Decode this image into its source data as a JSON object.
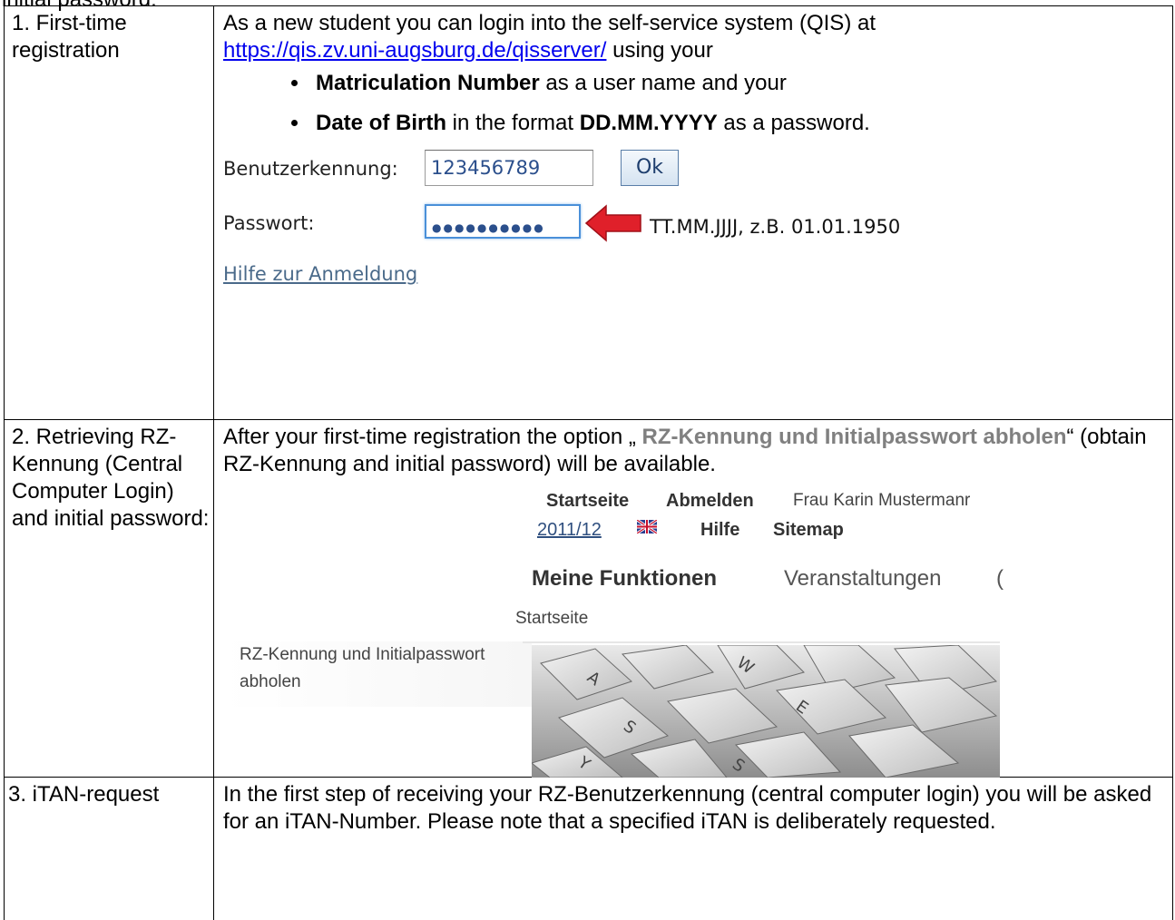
{
  "top_cut_text": "initial password:",
  "rows": [
    {
      "label": "1. First-time registration",
      "intro_pre": "As a new student you can login into the self-service system (QIS) at",
      "link": "https://qis.zv.uni-augsburg.de/qisserver/",
      "intro_post": " using your",
      "bullets": [
        {
          "bold": "Matriculation Number",
          "rest": " as a user name and your"
        },
        {
          "bold": "Date of Birth",
          "mid": " in the format ",
          "bold2": "DD.MM.YYYY",
          "rest": " as a password."
        }
      ],
      "login": {
        "user_label": "Benutzerkennung:",
        "user_value": "123456789",
        "ok_label": "Ok",
        "pass_label": "Passwort:",
        "pass_value": "●●●●●●●●●●",
        "annotation": "TT.MM.JJJJ, z.B. 01.01.1950",
        "help_link": "Hilfe zur Anmeldung"
      }
    },
    {
      "label": "2. Retrieving RZ-Kennung (Central Computer Login) and initial password:",
      "text_pre": "After your first-time registration the option „ ",
      "text_bold": "RZ-Kennung und Initialpasswort abholen",
      "text_post": "“ (obtain RZ-Kennung and initial password) will be available.",
      "qis": {
        "nav1": "Startseite",
        "nav2": "Abmelden",
        "user": "Frau Karin Mustermanr",
        "semester": "2011/12",
        "help": "Hilfe",
        "sitemap": "Sitemap",
        "tab1": "Meine Funktionen",
        "tab2": "Veranstaltungen",
        "tab3": "(",
        "breadcrumb": "Startseite",
        "option_line1": "RZ-Kennung und Initialpasswort",
        "option_line2": "abholen"
      }
    },
    {
      "label": "3. iTAN-request",
      "text": "In the first step of receiving your RZ-Benutzerkennung (central computer login) you will be asked for an iTAN-Number. Please note that a specified iTAN is deliberately requested."
    }
  ],
  "colors": {
    "link": "#0000ee",
    "arrow": "#e0202a",
    "muted_bold": "#808080"
  }
}
